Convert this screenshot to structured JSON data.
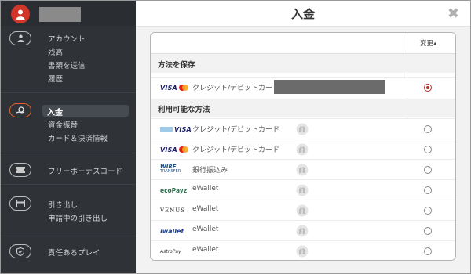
{
  "sidebar": {
    "account_label": "アカウント",
    "balance_label": "残高",
    "send_docs_label": "書類を送信",
    "history_label": "履歴",
    "deposit_label": "入金",
    "transfer_label": "資金振替",
    "card_payment_label": "カード＆決済情報",
    "bonus_code_label": "フリーボーナスコード",
    "withdraw_label": "引き出し",
    "pending_withdraw_label": "申請中の引き出し",
    "responsible_label": "責任あるプレイ"
  },
  "modal": {
    "title": "入金",
    "close_glyph": "✖",
    "sort_label": "変更▴",
    "saved_section_title": "方法を保存",
    "available_section_title": "利用可能な方法",
    "saved_methods": [
      {
        "logo": "visa-mastercard",
        "name": "クレジット/デビットカード",
        "selected": true
      }
    ],
    "available_methods": [
      {
        "logo": "visa-electron",
        "name": "クレジット/デビットカード",
        "selected": false
      },
      {
        "logo": "visa-mastercard",
        "name": "クレジット/デビットカード",
        "selected": false
      },
      {
        "logo": "wire-transfer",
        "name": "銀行振込み",
        "selected": false
      },
      {
        "logo": "ecopayz",
        "name": "eWallet",
        "selected": false
      },
      {
        "logo": "venus",
        "name": "eWallet",
        "selected": false
      },
      {
        "logo": "iwallet",
        "name": "eWallet",
        "selected": false
      },
      {
        "logo": "astropay",
        "name": "eWallet",
        "selected": false
      }
    ],
    "logo_texts": {
      "visa": "VISA",
      "wire_top": "WIRE",
      "wire_bottom": "TRANSFER",
      "eco": "ecoPayz",
      "venus": "VENUS",
      "iwallet": "iwallet",
      "astro": "AstroPay"
    }
  },
  "colors": {
    "accent": "#e0622a",
    "avatar": "#d2362b",
    "radio_selected": "#c02a2a"
  }
}
